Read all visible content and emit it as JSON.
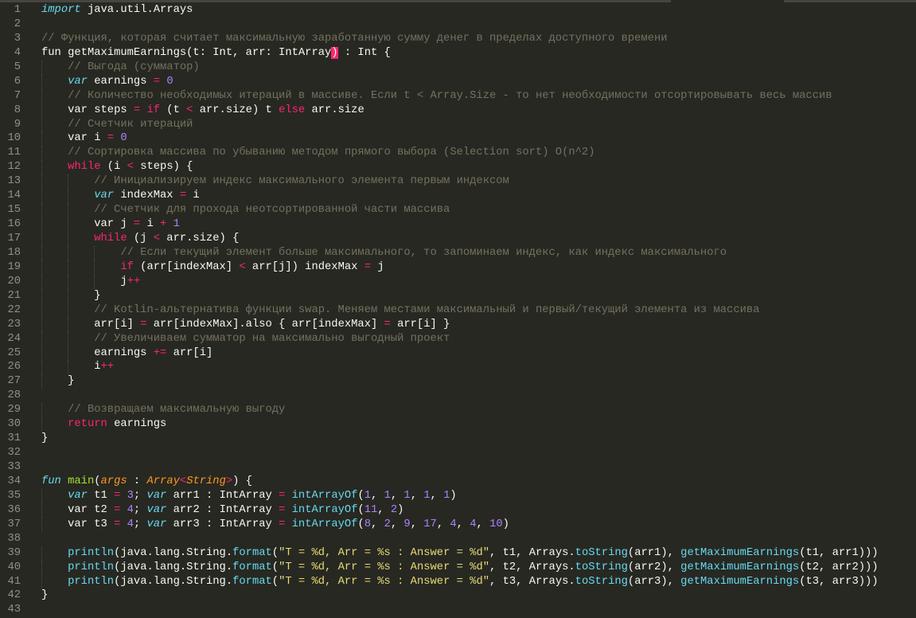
{
  "theme": {
    "background": "#272822",
    "comment": "#75715e",
    "keyword": "#f92672",
    "storage": "#66d9ef",
    "number": "#ae81ff",
    "string": "#e6db74",
    "function_name": "#a6e22e",
    "parameter": "#fd971f"
  },
  "code": {
    "lines": [
      {
        "ind": 0,
        "tokens": [
          {
            "c": "s",
            "t": "import"
          },
          {
            "c": "w",
            "t": " java.util.Arrays"
          }
        ]
      },
      {
        "ind": 0,
        "tokens": []
      },
      {
        "ind": 0,
        "tokens": [
          {
            "c": "c",
            "t": "// Функция, которая считает максимальную заработанную сумму денег в пределах доступного времени"
          }
        ]
      },
      {
        "ind": 0,
        "tokens": [
          {
            "c": "w",
            "t": "fun getMaximumEarnings(t: Int, arr: IntArray"
          },
          {
            "c": "b",
            "t": ")"
          },
          {
            "c": "w",
            "t": " : Int {"
          }
        ]
      },
      {
        "ind": 1,
        "tokens": [
          {
            "c": "c",
            "t": "// Выгода (сумматор)"
          }
        ]
      },
      {
        "ind": 1,
        "tokens": [
          {
            "c": "s",
            "t": "var"
          },
          {
            "c": "w",
            "t": " earnings "
          },
          {
            "c": "k",
            "t": "="
          },
          {
            "c": "w",
            "t": " "
          },
          {
            "c": "n",
            "t": "0"
          }
        ]
      },
      {
        "ind": 1,
        "tokens": [
          {
            "c": "c",
            "t": "// Количество необходимых итераций в массиве. Если t < Array.Size - то нет необходимости отсортировывать весь массив"
          }
        ]
      },
      {
        "ind": 1,
        "tokens": [
          {
            "c": "w",
            "t": "var steps "
          },
          {
            "c": "k",
            "t": "="
          },
          {
            "c": "w",
            "t": " "
          },
          {
            "c": "k",
            "t": "if"
          },
          {
            "c": "w",
            "t": " (t "
          },
          {
            "c": "k",
            "t": "<"
          },
          {
            "c": "w",
            "t": " arr.size) t "
          },
          {
            "c": "k",
            "t": "else"
          },
          {
            "c": "w",
            "t": " arr.size"
          }
        ]
      },
      {
        "ind": 1,
        "tokens": [
          {
            "c": "c",
            "t": "// Счетчик итераций"
          }
        ]
      },
      {
        "ind": 1,
        "tokens": [
          {
            "c": "w",
            "t": "var i "
          },
          {
            "c": "k",
            "t": "="
          },
          {
            "c": "w",
            "t": " "
          },
          {
            "c": "n",
            "t": "0"
          }
        ]
      },
      {
        "ind": 1,
        "tokens": [
          {
            "c": "c",
            "t": "// Сортировка массива по убыванию методом прямого выбора (Selection sort) O(n^2)"
          }
        ]
      },
      {
        "ind": 1,
        "tokens": [
          {
            "c": "k",
            "t": "while"
          },
          {
            "c": "w",
            "t": " (i "
          },
          {
            "c": "k",
            "t": "<"
          },
          {
            "c": "w",
            "t": " steps) {"
          }
        ]
      },
      {
        "ind": 2,
        "tokens": [
          {
            "c": "c",
            "t": "// Инициализируем индекс максимального элемента первым индексом"
          }
        ]
      },
      {
        "ind": 2,
        "tokens": [
          {
            "c": "s",
            "t": "var"
          },
          {
            "c": "w",
            "t": " indexMax "
          },
          {
            "c": "k",
            "t": "="
          },
          {
            "c": "w",
            "t": " i"
          }
        ]
      },
      {
        "ind": 2,
        "tokens": [
          {
            "c": "c",
            "t": "// Счетчик для прохода неотсортированной части массива"
          }
        ]
      },
      {
        "ind": 2,
        "tokens": [
          {
            "c": "w",
            "t": "var j "
          },
          {
            "c": "k",
            "t": "="
          },
          {
            "c": "w",
            "t": " i "
          },
          {
            "c": "k",
            "t": "+"
          },
          {
            "c": "w",
            "t": " "
          },
          {
            "c": "n",
            "t": "1"
          }
        ]
      },
      {
        "ind": 2,
        "tokens": [
          {
            "c": "k",
            "t": "while"
          },
          {
            "c": "w",
            "t": " (j "
          },
          {
            "c": "k",
            "t": "<"
          },
          {
            "c": "w",
            "t": " arr.size) {"
          }
        ]
      },
      {
        "ind": 3,
        "tokens": [
          {
            "c": "c",
            "t": "// Если текущий элемент больше максимального, то запоминаем индекс, как индекс максимального"
          }
        ]
      },
      {
        "ind": 3,
        "tokens": [
          {
            "c": "k",
            "t": "if"
          },
          {
            "c": "w",
            "t": " (arr[indexMax] "
          },
          {
            "c": "k",
            "t": "<"
          },
          {
            "c": "w",
            "t": " arr[j]) indexMax "
          },
          {
            "c": "k",
            "t": "="
          },
          {
            "c": "w",
            "t": " j"
          }
        ]
      },
      {
        "ind": 3,
        "tokens": [
          {
            "c": "w",
            "t": "j"
          },
          {
            "c": "k",
            "t": "++"
          }
        ]
      },
      {
        "ind": 2,
        "tokens": [
          {
            "c": "w",
            "t": "}"
          }
        ]
      },
      {
        "ind": 2,
        "tokens": [
          {
            "c": "c",
            "t": "// Kotlin-альтернатива функции swap. Меняем местами максимальный и первый/текущий элемента из массива"
          }
        ]
      },
      {
        "ind": 2,
        "tokens": [
          {
            "c": "w",
            "t": "arr[i] "
          },
          {
            "c": "k",
            "t": "="
          },
          {
            "c": "w",
            "t": " arr[indexMax].also { arr[indexMax] "
          },
          {
            "c": "k",
            "t": "="
          },
          {
            "c": "w",
            "t": " arr[i] }"
          }
        ]
      },
      {
        "ind": 2,
        "tokens": [
          {
            "c": "c",
            "t": "// Увеличиваем сумматор на максимально выгодный проект"
          }
        ]
      },
      {
        "ind": 2,
        "tokens": [
          {
            "c": "w",
            "t": "earnings "
          },
          {
            "c": "k",
            "t": "+="
          },
          {
            "c": "w",
            "t": " arr[i]"
          }
        ]
      },
      {
        "ind": 2,
        "tokens": [
          {
            "c": "w",
            "t": "i"
          },
          {
            "c": "k",
            "t": "++"
          }
        ]
      },
      {
        "ind": 1,
        "tokens": [
          {
            "c": "w",
            "t": "}"
          }
        ]
      },
      {
        "ind": 0,
        "tokens": []
      },
      {
        "ind": 1,
        "tokens": [
          {
            "c": "c",
            "t": "// Возвращаем максимальную выгоду"
          }
        ]
      },
      {
        "ind": 1,
        "tokens": [
          {
            "c": "k",
            "t": "return"
          },
          {
            "c": "w",
            "t": " earnings"
          }
        ]
      },
      {
        "ind": 0,
        "tokens": [
          {
            "c": "w",
            "t": "}"
          }
        ]
      },
      {
        "ind": 0,
        "tokens": []
      },
      {
        "ind": 0,
        "tokens": []
      },
      {
        "ind": 0,
        "tokens": [
          {
            "c": "s",
            "t": "fun"
          },
          {
            "c": "w",
            "t": " "
          },
          {
            "c": "g",
            "t": "main"
          },
          {
            "c": "w",
            "t": "("
          },
          {
            "c": "o",
            "t": "args"
          },
          {
            "c": "w",
            "t": " : "
          },
          {
            "c": "o",
            "t": "Array"
          },
          {
            "c": "k",
            "t": "<"
          },
          {
            "c": "o",
            "t": "String"
          },
          {
            "c": "k",
            "t": ">"
          },
          {
            "c": "w",
            "t": ") {"
          }
        ]
      },
      {
        "ind": 1,
        "tokens": [
          {
            "c": "s",
            "t": "var"
          },
          {
            "c": "w",
            "t": " t1 "
          },
          {
            "c": "k",
            "t": "="
          },
          {
            "c": "w",
            "t": " "
          },
          {
            "c": "n",
            "t": "3"
          },
          {
            "c": "w",
            "t": "; "
          },
          {
            "c": "s",
            "t": "var"
          },
          {
            "c": "w",
            "t": " arr1 : IntArray "
          },
          {
            "c": "k",
            "t": "="
          },
          {
            "c": "w",
            "t": " "
          },
          {
            "c": "f",
            "t": "intArrayOf"
          },
          {
            "c": "w",
            "t": "("
          },
          {
            "c": "n",
            "t": "1"
          },
          {
            "c": "w",
            "t": ", "
          },
          {
            "c": "n",
            "t": "1"
          },
          {
            "c": "w",
            "t": ", "
          },
          {
            "c": "n",
            "t": "1"
          },
          {
            "c": "w",
            "t": ", "
          },
          {
            "c": "n",
            "t": "1"
          },
          {
            "c": "w",
            "t": ", "
          },
          {
            "c": "n",
            "t": "1"
          },
          {
            "c": "w",
            "t": ")"
          }
        ]
      },
      {
        "ind": 1,
        "tokens": [
          {
            "c": "w",
            "t": "var t2 "
          },
          {
            "c": "k",
            "t": "="
          },
          {
            "c": "w",
            "t": " "
          },
          {
            "c": "n",
            "t": "4"
          },
          {
            "c": "w",
            "t": "; "
          },
          {
            "c": "s",
            "t": "var"
          },
          {
            "c": "w",
            "t": " arr2 : IntArray "
          },
          {
            "c": "k",
            "t": "="
          },
          {
            "c": "w",
            "t": " "
          },
          {
            "c": "f",
            "t": "intArrayOf"
          },
          {
            "c": "w",
            "t": "("
          },
          {
            "c": "n",
            "t": "11"
          },
          {
            "c": "w",
            "t": ", "
          },
          {
            "c": "n",
            "t": "2"
          },
          {
            "c": "w",
            "t": ")"
          }
        ]
      },
      {
        "ind": 1,
        "tokens": [
          {
            "c": "w",
            "t": "var t3 "
          },
          {
            "c": "k",
            "t": "="
          },
          {
            "c": "w",
            "t": " "
          },
          {
            "c": "n",
            "t": "4"
          },
          {
            "c": "w",
            "t": "; "
          },
          {
            "c": "s",
            "t": "var"
          },
          {
            "c": "w",
            "t": " arr3 : IntArray "
          },
          {
            "c": "k",
            "t": "="
          },
          {
            "c": "w",
            "t": " "
          },
          {
            "c": "f",
            "t": "intArrayOf"
          },
          {
            "c": "w",
            "t": "("
          },
          {
            "c": "n",
            "t": "8"
          },
          {
            "c": "w",
            "t": ", "
          },
          {
            "c": "n",
            "t": "2"
          },
          {
            "c": "w",
            "t": ", "
          },
          {
            "c": "n",
            "t": "9"
          },
          {
            "c": "w",
            "t": ", "
          },
          {
            "c": "n",
            "t": "17"
          },
          {
            "c": "w",
            "t": ", "
          },
          {
            "c": "n",
            "t": "4"
          },
          {
            "c": "w",
            "t": ", "
          },
          {
            "c": "n",
            "t": "4"
          },
          {
            "c": "w",
            "t": ", "
          },
          {
            "c": "n",
            "t": "10"
          },
          {
            "c": "w",
            "t": ")"
          }
        ]
      },
      {
        "ind": 0,
        "tokens": []
      },
      {
        "ind": 1,
        "tokens": [
          {
            "c": "f",
            "t": "println"
          },
          {
            "c": "w",
            "t": "(java.lang.String."
          },
          {
            "c": "f",
            "t": "format"
          },
          {
            "c": "w",
            "t": "("
          },
          {
            "c": "y",
            "t": "\"T = %d, Arr = %s : Answer = %d\""
          },
          {
            "c": "w",
            "t": ", t1, Arrays."
          },
          {
            "c": "f",
            "t": "toString"
          },
          {
            "c": "w",
            "t": "(arr1), "
          },
          {
            "c": "f",
            "t": "getMaximumEarnings"
          },
          {
            "c": "w",
            "t": "(t1, arr1)))"
          }
        ]
      },
      {
        "ind": 1,
        "tokens": [
          {
            "c": "f",
            "t": "println"
          },
          {
            "c": "w",
            "t": "(java.lang.String."
          },
          {
            "c": "f",
            "t": "format"
          },
          {
            "c": "w",
            "t": "("
          },
          {
            "c": "y",
            "t": "\"T = %d, Arr = %s : Answer = %d\""
          },
          {
            "c": "w",
            "t": ", t2, Arrays."
          },
          {
            "c": "f",
            "t": "toString"
          },
          {
            "c": "w",
            "t": "(arr2), "
          },
          {
            "c": "f",
            "t": "getMaximumEarnings"
          },
          {
            "c": "w",
            "t": "(t2, arr2)))"
          }
        ]
      },
      {
        "ind": 1,
        "tokens": [
          {
            "c": "f",
            "t": "println"
          },
          {
            "c": "w",
            "t": "(java.lang.String."
          },
          {
            "c": "f",
            "t": "format"
          },
          {
            "c": "w",
            "t": "("
          },
          {
            "c": "y",
            "t": "\"T = %d, Arr = %s : Answer = %d\""
          },
          {
            "c": "w",
            "t": ", t3, Arrays."
          },
          {
            "c": "f",
            "t": "toString"
          },
          {
            "c": "w",
            "t": "(arr3), "
          },
          {
            "c": "f",
            "t": "getMaximumEarnings"
          },
          {
            "c": "w",
            "t": "(t3, arr3)))"
          }
        ]
      },
      {
        "ind": 0,
        "tokens": [
          {
            "c": "w",
            "t": "}"
          }
        ]
      },
      {
        "ind": 0,
        "tokens": []
      }
    ]
  }
}
